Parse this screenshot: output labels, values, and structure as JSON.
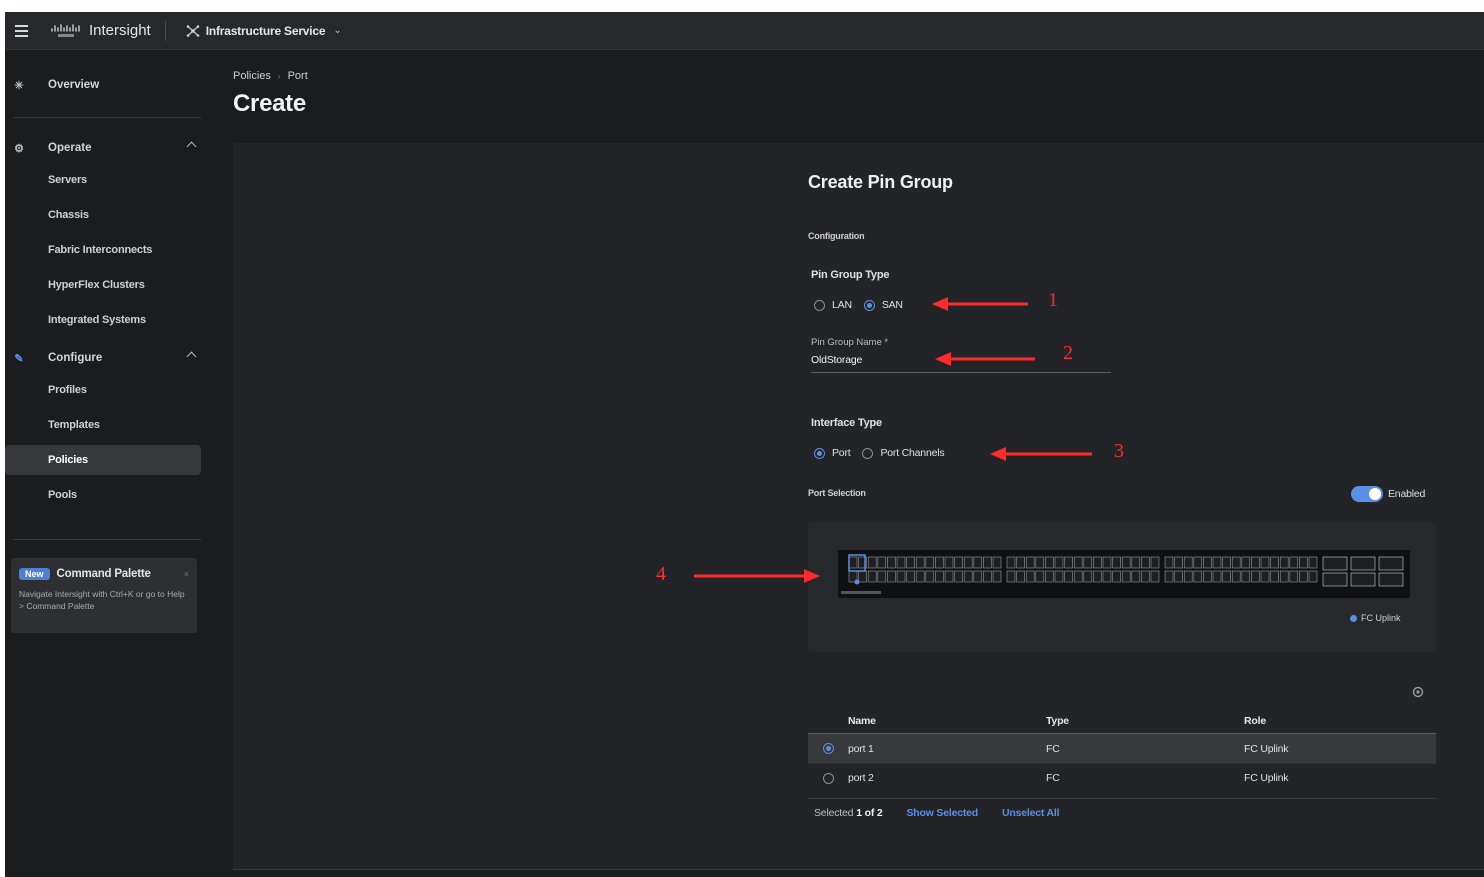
{
  "topbar": {
    "brand": "Intersight",
    "service": "Infrastructure Service"
  },
  "sidebar": {
    "overview": "Overview",
    "operate": {
      "label": "Operate",
      "items": [
        "Servers",
        "Chassis",
        "Fabric Interconnects",
        "HyperFlex Clusters",
        "Integrated Systems"
      ]
    },
    "configure": {
      "label": "Configure",
      "items": [
        "Profiles",
        "Templates",
        "Policies",
        "Pools"
      ],
      "active": "Policies"
    },
    "command_palette": {
      "badge": "New",
      "title": "Command Palette",
      "close": "×",
      "description": "Navigate Intersight with Ctrl+K or go to Help > Command Palette"
    }
  },
  "breadcrumb": [
    "Policies",
    "Port"
  ],
  "page_title": "Create",
  "form": {
    "title": "Create Pin Group",
    "section": "Configuration",
    "pin_group_type": {
      "label": "Pin Group Type",
      "options": [
        "LAN",
        "SAN"
      ],
      "selected": "SAN"
    },
    "pin_group_name": {
      "label": "Pin Group Name *",
      "value": "OldStorage"
    },
    "interface_type": {
      "label": "Interface Type",
      "options": [
        "Port",
        "Port Channels"
      ],
      "selected": "Port"
    },
    "port_selection": {
      "label": "Port Selection",
      "toggle_label": "Enabled",
      "toggle_on": true,
      "legend": "FC Uplink",
      "legend_color": "#5b8fe6"
    },
    "table": {
      "columns": [
        "Name",
        "Type",
        "Role"
      ],
      "rows": [
        {
          "name": "port 1",
          "type": "FC",
          "role": "FC Uplink",
          "selected": true
        },
        {
          "name": "port 2",
          "type": "FC",
          "role": "FC Uplink",
          "selected": false
        }
      ],
      "footer": {
        "selected_prefix": "Selected",
        "selected_count": "1 of 2",
        "show_selected": "Show Selected",
        "unselect_all": "Unselect All"
      }
    }
  },
  "annotations": [
    "1",
    "2",
    "3",
    "4"
  ],
  "colors": {
    "accent": "#5b8fe6",
    "annotation": "#ff2a2a",
    "background": "#1b1c1e",
    "panel": "#232427"
  }
}
